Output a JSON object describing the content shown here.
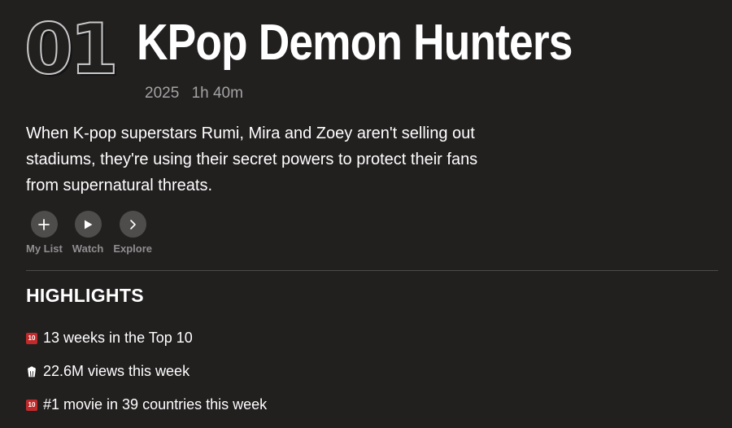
{
  "title": {
    "rank": "01",
    "name": "KPop Demon Hunters",
    "year": "2025",
    "duration": "1h 40m"
  },
  "synopsis": "When K-pop superstars Rumi, Mira and Zoey aren't selling out stadiums, they're using their secret powers to protect their fans from supernatural threats.",
  "actions": {
    "my_list": "My List",
    "watch": "Watch",
    "explore": "Explore"
  },
  "highlights": {
    "heading": "HIGHLIGHTS",
    "items": [
      {
        "icon": "top10-icon",
        "icon_text": "10",
        "text": "13 weeks in the Top 10"
      },
      {
        "icon": "popcorn-icon",
        "text": "22.6M views this week"
      },
      {
        "icon": "top10-icon",
        "icon_text": "10",
        "text": "#1 movie in 39 countries this week"
      }
    ]
  },
  "colors": {
    "background": "#221f1f",
    "badge_red": "#c12a2a",
    "action_circle": "#4f4c4c",
    "muted_text": "#a3a3a3"
  }
}
